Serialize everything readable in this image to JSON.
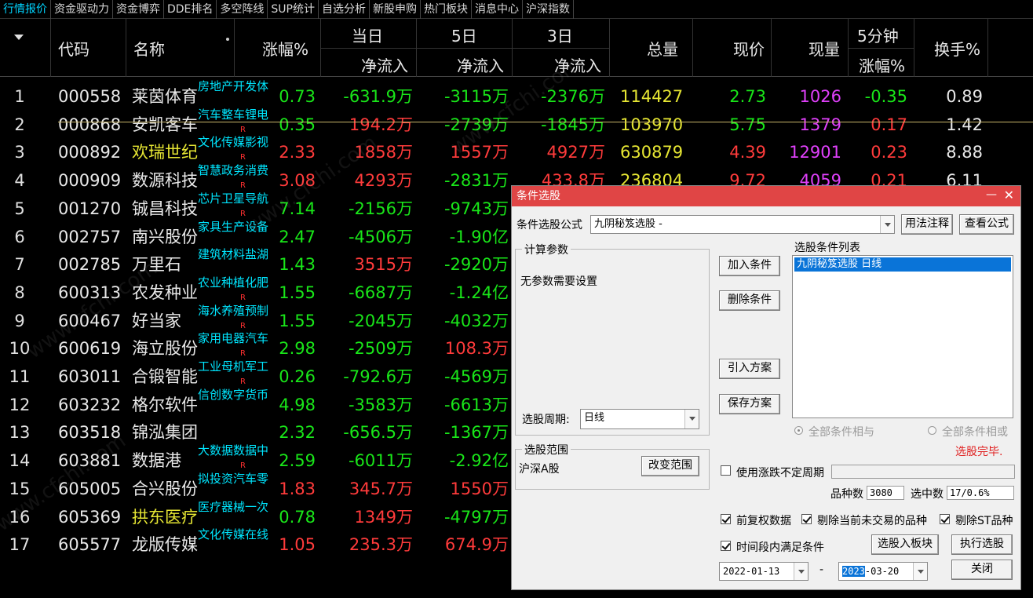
{
  "tabs": [
    "行情报价",
    "资金驱动力",
    "资金博弈",
    "DDE排名",
    "多空阵线",
    "SUP统计",
    "自选分析",
    "新股申购",
    "热门板块",
    "消息中心",
    "沪深指数"
  ],
  "active_tab": 0,
  "header": {
    "code": "代码",
    "name": "名称",
    "chg": "涨幅%",
    "day1": "当日",
    "day5": "5日",
    "day3": "3日",
    "netflow": "净流入",
    "volume": "总量",
    "price": "现价",
    "current": "现量",
    "min5": "5分钟",
    "min5_sub": "涨幅%",
    "turnover": "换手%"
  },
  "rows": [
    {
      "idx": "1",
      "code": "000558",
      "name": "莱茵体育",
      "name_color": "white",
      "sector": "房地产开发体",
      "r": "",
      "chg": "0.73",
      "chg_c": "green",
      "d1": "-631.9万",
      "d1_c": "green",
      "d5": "-3115万",
      "d5_c": "green",
      "d3": "-2376万",
      "d3_c": "green",
      "vol": "114427",
      "px": "2.73",
      "px_c": "green",
      "cur": "1026",
      "m5": "-0.35",
      "m5_c": "green",
      "turn": "0.89"
    },
    {
      "idx": "2",
      "code": "000868",
      "name": "安凯客车",
      "name_color": "white",
      "sector": "汽车整车锂电",
      "r": "R",
      "chg": "0.35",
      "chg_c": "green",
      "d1": "194.2万",
      "d1_c": "red",
      "d5": "-2739万",
      "d5_c": "green",
      "d3": "-1845万",
      "d3_c": "green",
      "vol": "103970",
      "px": "5.75",
      "px_c": "green",
      "cur": "1379",
      "m5": "0.17",
      "m5_c": "red",
      "turn": "1.42"
    },
    {
      "idx": "3",
      "code": "000892",
      "name": "欢瑞世纪",
      "name_color": "yellow",
      "sector": "文化传媒影视",
      "r": "R",
      "chg": "2.33",
      "chg_c": "red",
      "d1": "1858万",
      "d1_c": "red",
      "d5": "1557万",
      "d5_c": "red",
      "d3": "4927万",
      "d3_c": "red",
      "vol": "630879",
      "px": "4.39",
      "px_c": "red",
      "cur": "12901",
      "m5": "0.23",
      "m5_c": "red",
      "turn": "8.88"
    },
    {
      "idx": "4",
      "code": "000909",
      "name": "数源科技",
      "name_color": "white",
      "sector": "智慧政务消费",
      "r": "R",
      "chg": "3.08",
      "chg_c": "red",
      "d1": "4293万",
      "d1_c": "red",
      "d5": "-2831万",
      "d5_c": "green",
      "d3": "433.8万",
      "d3_c": "red",
      "vol": "236804",
      "px": "9.72",
      "px_c": "red",
      "cur": "4059",
      "m5": "0.21",
      "m5_c": "red",
      "turn": "6.11"
    },
    {
      "idx": "5",
      "code": "001270",
      "name": "铖昌科技",
      "name_color": "white",
      "sector": "芯片卫星导航",
      "r": "R",
      "chg": "7.14",
      "chg_c": "green",
      "d1": "-2156万",
      "d1_c": "green",
      "d5": "-9743万",
      "d5_c": "green",
      "d3": "",
      "d3_c": "green",
      "vol": "",
      "px": "",
      "px_c": "green",
      "cur": "",
      "m5": "",
      "m5_c": "green",
      "turn": ""
    },
    {
      "idx": "6",
      "code": "002757",
      "name": "南兴股份",
      "name_color": "white",
      "sector": "家具生产设备",
      "r": "",
      "chg": "2.47",
      "chg_c": "green",
      "d1": "-4506万",
      "d1_c": "green",
      "d5": "-1.90亿",
      "d5_c": "green",
      "d3": "",
      "d3_c": "green",
      "vol": "",
      "px": "",
      "px_c": "green",
      "cur": "",
      "m5": "",
      "m5_c": "green",
      "turn": ""
    },
    {
      "idx": "7",
      "code": "002785",
      "name": "万里石",
      "name_color": "white",
      "sector": "建筑材料盐湖",
      "r": "",
      "chg": "1.43",
      "chg_c": "green",
      "d1": "3515万",
      "d1_c": "red",
      "d5": "-2920万",
      "d5_c": "green",
      "d3": "",
      "d3_c": "green",
      "vol": "",
      "px": "",
      "px_c": "green",
      "cur": "",
      "m5": "",
      "m5_c": "green",
      "turn": ""
    },
    {
      "idx": "8",
      "code": "600313",
      "name": "农发种业",
      "name_color": "white",
      "sector": "农业种植化肥",
      "r": "R",
      "chg": "1.55",
      "chg_c": "green",
      "d1": "-6687万",
      "d1_c": "green",
      "d5": "-1.24亿",
      "d5_c": "green",
      "d3": "",
      "d3_c": "green",
      "vol": "",
      "px": "",
      "px_c": "green",
      "cur": "",
      "m5": "",
      "m5_c": "green",
      "turn": ""
    },
    {
      "idx": "9",
      "code": "600467",
      "name": "好当家",
      "name_color": "white",
      "sector": "海水养殖预制",
      "r": "R",
      "chg": "1.55",
      "chg_c": "green",
      "d1": "-2045万",
      "d1_c": "green",
      "d5": "-4032万",
      "d5_c": "green",
      "d3": "",
      "d3_c": "green",
      "vol": "",
      "px": "",
      "px_c": "green",
      "cur": "",
      "m5": "",
      "m5_c": "green",
      "turn": ""
    },
    {
      "idx": "10",
      "code": "600619",
      "name": "海立股份",
      "name_color": "white",
      "sector": "家用电器汽车",
      "r": "R",
      "chg": "2.98",
      "chg_c": "green",
      "d1": "-2509万",
      "d1_c": "green",
      "d5": "108.3万",
      "d5_c": "red",
      "d3": "",
      "d3_c": "green",
      "vol": "",
      "px": "",
      "px_c": "green",
      "cur": "",
      "m5": "",
      "m5_c": "green",
      "turn": ""
    },
    {
      "idx": "11",
      "code": "603011",
      "name": "合锻智能",
      "name_color": "white",
      "sector": "工业母机军工",
      "r": "R",
      "chg": "0.26",
      "chg_c": "green",
      "d1": "-792.6万",
      "d1_c": "green",
      "d5": "-4569万",
      "d5_c": "green",
      "d3": "",
      "d3_c": "green",
      "vol": "",
      "px": "",
      "px_c": "green",
      "cur": "",
      "m5": "",
      "m5_c": "green",
      "turn": ""
    },
    {
      "idx": "12",
      "code": "603232",
      "name": "格尔软件",
      "name_color": "white",
      "sector": "信创数字货币",
      "r": "",
      "chg": "4.98",
      "chg_c": "green",
      "d1": "-3583万",
      "d1_c": "green",
      "d5": "-6613万",
      "d5_c": "green",
      "d3": "",
      "d3_c": "green",
      "vol": "",
      "px": "",
      "px_c": "green",
      "cur": "",
      "m5": "",
      "m5_c": "green",
      "turn": ""
    },
    {
      "idx": "13",
      "code": "603518",
      "name": "锦泓集团",
      "name_color": "white",
      "sector": "",
      "r": "",
      "chg": "2.32",
      "chg_c": "green",
      "d1": "-656.5万",
      "d1_c": "green",
      "d5": "-1367万",
      "d5_c": "green",
      "d3": "",
      "d3_c": "green",
      "vol": "",
      "px": "",
      "px_c": "green",
      "cur": "",
      "m5": "",
      "m5_c": "green",
      "turn": ""
    },
    {
      "idx": "14",
      "code": "603881",
      "name": "数据港",
      "name_color": "white",
      "sector": "大数据数据中",
      "r": "R",
      "chg": "2.59",
      "chg_c": "green",
      "d1": "-6011万",
      "d1_c": "green",
      "d5": "-2.92亿",
      "d5_c": "green",
      "d3": "",
      "d3_c": "green",
      "vol": "",
      "px": "",
      "px_c": "green",
      "cur": "",
      "m5": "",
      "m5_c": "green",
      "turn": ""
    },
    {
      "idx": "15",
      "code": "605005",
      "name": "合兴股份",
      "name_color": "white",
      "sector": "拟投资汽车零",
      "r": "",
      "chg": "1.83",
      "chg_c": "red",
      "d1": "345.7万",
      "d1_c": "red",
      "d5": "1550万",
      "d5_c": "red",
      "d3": "",
      "d3_c": "green",
      "vol": "",
      "px": "",
      "px_c": "green",
      "cur": "",
      "m5": "",
      "m5_c": "green",
      "turn": ""
    },
    {
      "idx": "16",
      "code": "605369",
      "name": "拱东医疗",
      "name_color": "yellow",
      "sector": "医疗器械一次",
      "r": "",
      "chg": "0.78",
      "chg_c": "green",
      "d1": "1349万",
      "d1_c": "red",
      "d5": "-4797万",
      "d5_c": "green",
      "d3": "",
      "d3_c": "green",
      "vol": "",
      "px": "",
      "px_c": "green",
      "cur": "",
      "m5": "",
      "m5_c": "green",
      "turn": ""
    },
    {
      "idx": "17",
      "code": "605577",
      "name": "龙版传媒",
      "name_color": "white",
      "sector": "文化传媒在线",
      "r": "",
      "chg": "1.05",
      "chg_c": "red",
      "d1": "235.3万",
      "d1_c": "red",
      "d5": "674.9万",
      "d5_c": "red",
      "d3": "",
      "d3_c": "green",
      "vol": "",
      "px": "",
      "px_c": "green",
      "cur": "",
      "m5": "",
      "m5_c": "green",
      "turn": ""
    }
  ],
  "dialog": {
    "title": "条件选股",
    "formula_label": "条件选股公式",
    "formula_value": "九阴秘笈选股 -",
    "usage_btn": "用法注释",
    "view_formula_btn": "查看公式",
    "params_group": "计算参数",
    "no_params": "无参数需要设置",
    "period_label": "选股周期:",
    "period_value": "日线",
    "add_cond_btn": "加入条件",
    "del_cond_btn": "删除条件",
    "import_btn": "引入方案",
    "save_btn": "保存方案",
    "cond_list_label": "选股条件列表",
    "cond_item": "九阴秘笈选股  日线",
    "radio_and": "全部条件相与",
    "radio_or": "全部条件相或",
    "status": "选股完毕.",
    "range_group": "选股范围",
    "range_value": "沪深A股",
    "change_range_btn": "改变范围",
    "variable_period": "使用涨跌不定周期",
    "count_label": "品种数",
    "count_value": "3080",
    "selected_label": "选中数",
    "selected_value": "17/0.6%",
    "pre_adjust": "前复权数据",
    "exclude_untraded": "剔除当前未交易的品种",
    "exclude_st": "剔除ST品种",
    "time_range": "时间段内满足条件",
    "to_board_btn": "选股入板块",
    "execute_btn": "执行选股",
    "close_btn": "关闭",
    "date_from": "2022-01-13",
    "date_sep": "-",
    "date_to_year": "2023",
    "date_to_rest": "-03-20"
  },
  "watermark": "www.cfchi.com"
}
